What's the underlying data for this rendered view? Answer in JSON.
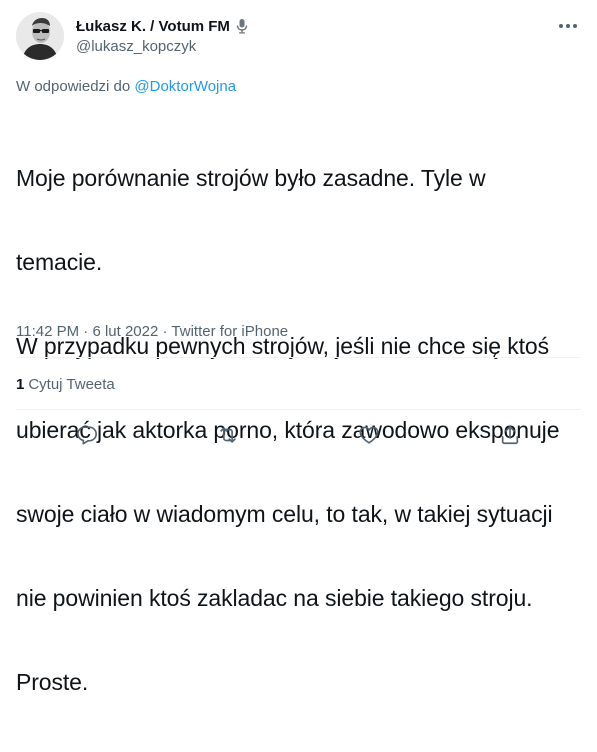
{
  "author": {
    "display_name": "Łukasz K. / Votum FM",
    "handle": "@lukasz_kopczyk",
    "badge_icon": "microphone-icon",
    "avatar_icon": "avatar-icon"
  },
  "menu": {
    "more_icon": "more-icon"
  },
  "reply_context": {
    "prefix": "W odpowiedzi do",
    "mention": "@DoktorWojna"
  },
  "tweet": {
    "line1": "Moje porównanie strojów było zasadne. Tyle w",
    "line2": "temacie.",
    "line3": "W przypadku pewnych strojów, jeśli nie chce się ktoś",
    "line4": "ubierać jak aktorka porno, która zawodowo eksponuje",
    "line5": "swoje ciało w wiadomym celu, to tak, w takiej sytuacji",
    "line6": "nie powinien ktoś zakladac na siebie takiego stroju.",
    "line7": "Proste."
  },
  "meta": {
    "time": "11:42 PM",
    "separator": "·",
    "date": "6 lut 2022",
    "source": "Twitter for iPhone"
  },
  "stats": {
    "quote_count": "1",
    "quote_label": "Cytuj Tweeta"
  },
  "actions": [
    {
      "icon": "reply-icon"
    },
    {
      "icon": "retweet-icon"
    },
    {
      "icon": "like-icon"
    },
    {
      "icon": "share-icon"
    }
  ],
  "colors": {
    "text_primary": "#0f1419",
    "text_secondary": "#536471",
    "accent": "#1d9bf0",
    "divider": "#eff3f4"
  }
}
